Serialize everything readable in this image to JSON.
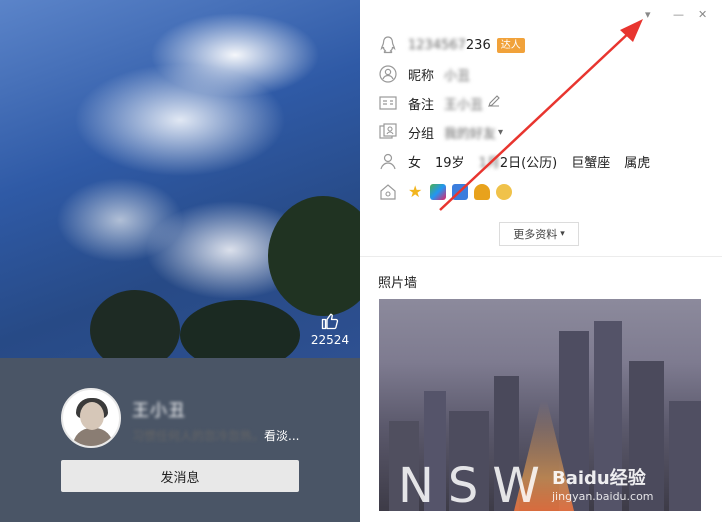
{
  "cover": {
    "likes": "22524"
  },
  "profile": {
    "nickname": "王小丑",
    "signature_blurred": "习惯任何人的忽冷忽热，",
    "signature_tail": "看淡...",
    "send_message_label": "发消息"
  },
  "window": {
    "dropdown_icon": "▾",
    "minimize_icon": "—",
    "close_icon": "✕"
  },
  "info": {
    "qq_number_blurred": "1234567",
    "qq_number_suffix": "236",
    "vip_badge": "达人",
    "nickname_label": "昵称",
    "nickname_value": "小丑",
    "remark_label": "备注",
    "remark_value": "王小丑",
    "group_label": "分组",
    "group_value": "我的好友",
    "gender": "女",
    "age": "19岁",
    "birthday_blurred": "1月",
    "birthday_suffix": "2日(公历)",
    "zodiac": "巨蟹座",
    "chinese_zodiac": "属虎",
    "more_label": "更多资料",
    "more_arrow": "▾"
  },
  "photos": {
    "title": "照片墙"
  },
  "watermark": {
    "letters": "NSW",
    "brand": "Baidu经验",
    "url": "jingyan.baidu.com"
  },
  "colors": {
    "annotation_arrow": "#e8352f",
    "profile_bar": "#4a5566",
    "badge": "#f1a23a"
  }
}
